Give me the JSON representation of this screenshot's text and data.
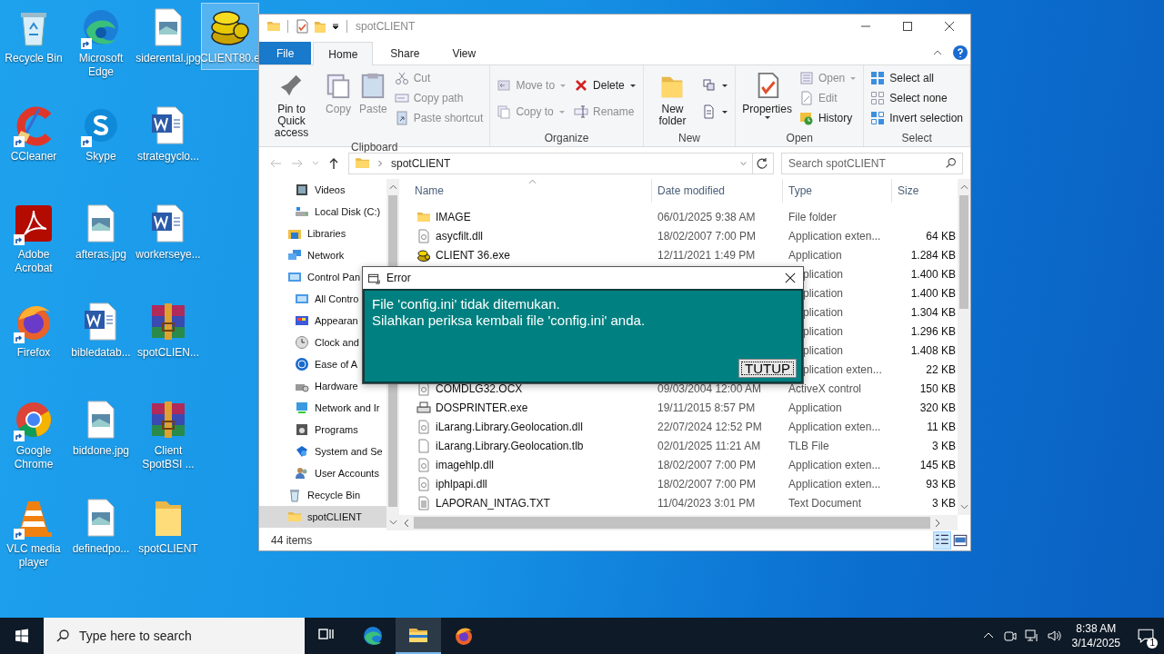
{
  "desktop": {
    "columns": [
      [
        {
          "label": "Recycle Bin",
          "kind": "recycle",
          "shortcut": false,
          "selected": false
        },
        {
          "label": "CCleaner",
          "kind": "ccleaner",
          "shortcut": true,
          "selected": false
        },
        {
          "label": "Adobe Acrobat",
          "kind": "acrobat",
          "shortcut": true,
          "selected": false
        },
        {
          "label": "Firefox",
          "kind": "firefox",
          "shortcut": true,
          "selected": false
        },
        {
          "label": "Google Chrome",
          "kind": "chrome",
          "shortcut": true,
          "selected": false
        },
        {
          "label": "VLC media player",
          "kind": "vlc",
          "shortcut": true,
          "selected": false
        }
      ],
      [
        {
          "label": "Microsoft Edge",
          "kind": "edge",
          "shortcut": true,
          "selected": false
        },
        {
          "label": "Skype",
          "kind": "skype",
          "shortcut": true,
          "selected": false
        },
        {
          "label": "afteras.jpg",
          "kind": "image",
          "shortcut": false,
          "selected": false
        },
        {
          "label": "bibledatab...",
          "kind": "word",
          "shortcut": false,
          "selected": false
        },
        {
          "label": "biddone.jpg",
          "kind": "image",
          "shortcut": false,
          "selected": false
        },
        {
          "label": "definedpo...",
          "kind": "image",
          "shortcut": false,
          "selected": false
        }
      ],
      [
        {
          "label": "siderental.jpg",
          "kind": "image",
          "shortcut": false,
          "selected": false
        },
        {
          "label": "strategyclo...",
          "kind": "word",
          "shortcut": false,
          "selected": false
        },
        {
          "label": "workerseye...",
          "kind": "word",
          "shortcut": false,
          "selected": false
        },
        {
          "label": "spotCLIEN...",
          "kind": "archive",
          "shortcut": false,
          "selected": false
        },
        {
          "label": "Client SpotBSI ...",
          "kind": "archive",
          "shortcut": false,
          "selected": false
        },
        {
          "label": "spotCLIENT",
          "kind": "folder",
          "shortcut": false,
          "selected": false
        }
      ],
      [
        {
          "label": "CLIENT80.e",
          "kind": "coins",
          "shortcut": false,
          "selected": true
        }
      ]
    ]
  },
  "explorer": {
    "title": "spotCLIENT",
    "tabs": [
      {
        "label": "File",
        "kind": "file",
        "selected": false
      },
      {
        "label": "Home",
        "kind": "tab",
        "selected": true
      },
      {
        "label": "Share",
        "kind": "tab",
        "selected": false
      },
      {
        "label": "View",
        "kind": "tab",
        "selected": false
      }
    ],
    "ribbon": [
      {
        "label": "Clipboard",
        "columns": [
          [
            {
              "label": "Pin to Quick access",
              "kind": "large",
              "disabled": false
            }
          ],
          [
            {
              "label": "Copy",
              "kind": "large",
              "disabled": true
            }
          ],
          [
            {
              "label": "Paste",
              "kind": "large",
              "disabled": true
            }
          ],
          [
            {
              "label": "Cut",
              "kind": "small",
              "disabled": true
            },
            {
              "label": "Copy path",
              "kind": "small",
              "disabled": true
            },
            {
              "label": "Paste shortcut",
              "kind": "small",
              "disabled": true
            }
          ]
        ]
      },
      {
        "label": "Organize",
        "columns": [
          [
            {
              "label": "Move to",
              "kind": "small",
              "disabled": true,
              "dropdown": true
            },
            {
              "label": "Copy to",
              "kind": "small",
              "disabled": true,
              "dropdown": true
            }
          ],
          [
            {
              "label": "Delete",
              "kind": "small",
              "disabled": false,
              "dropdown": true
            },
            {
              "label": "Rename",
              "kind": "small",
              "disabled": true
            }
          ]
        ]
      },
      {
        "label": "New",
        "columns": [
          [
            {
              "label": "New folder",
              "kind": "large",
              "disabled": false
            }
          ],
          [
            {
              "kind": "icon",
              "disabled": false,
              "dropdown": true
            },
            {
              "kind": "icon",
              "disabled": false,
              "dropdown": true
            }
          ]
        ]
      },
      {
        "label": "Open",
        "columns": [
          [
            {
              "label": "Properties",
              "kind": "large",
              "disabled": false,
              "dropdown": true
            }
          ],
          [
            {
              "label": "Open",
              "kind": "small",
              "disabled": true,
              "dropdown": true
            },
            {
              "label": "Edit",
              "kind": "small",
              "disabled": true
            },
            {
              "label": "History",
              "kind": "small",
              "disabled": false
            }
          ]
        ]
      },
      {
        "label": "Select",
        "columns": [
          [
            {
              "label": "Select all",
              "kind": "small",
              "disabled": false
            },
            {
              "label": "Select none",
              "kind": "small",
              "disabled": false
            },
            {
              "label": "Invert selection",
              "kind": "small",
              "disabled": false
            }
          ]
        ]
      }
    ],
    "address": "spotCLIENT",
    "search": {
      "placeholder": "Search spotCLIENT"
    },
    "nav_pane": {
      "items": [
        {
          "children": [
            {
              "label": "Videos",
              "selected": false
            },
            {
              "label": "Local Disk (C:)",
              "selected": false
            }
          ]
        },
        {
          "label": "Libraries",
          "selected": false
        },
        {
          "label": "Network",
          "selected": false
        },
        {
          "label": "Control Pan",
          "selected": false,
          "children": [
            {
              "label": "All Contro",
              "selected": false
            },
            {
              "label": "Appearan",
              "selected": false
            },
            {
              "label": "Clock and",
              "selected": false
            },
            {
              "label": "Ease of A",
              "selected": false
            },
            {
              "label": "Hardware",
              "selected": false
            },
            {
              "label": "Network and Ir",
              "selected": false
            },
            {
              "label": "Programs",
              "selected": false
            },
            {
              "label": "System and Se",
              "selected": false
            },
            {
              "label": "User Accounts",
              "selected": false
            }
          ]
        },
        {
          "label": "Recycle Bin",
          "selected": false
        },
        {
          "label": "spotCLIENT",
          "selected": true
        }
      ]
    },
    "file_list": {
      "columns": [
        "Name",
        "Date modified",
        "Type",
        "Size"
      ],
      "rows": [
        {
          "name": "IMAGE",
          "date": "06/01/2025 9:38 AM",
          "type": "File folder"
        },
        {
          "name": "asycfilt.dll",
          "date": "18/02/2007 7:00 PM",
          "type": "Application exten...",
          "size": "64 KB"
        },
        {
          "name": "CLIENT 36.exe",
          "date": "12/11/2021 1:49 PM",
          "type": "Application",
          "size": "1.284 KB"
        },
        {
          "type": "plication",
          "size": "1.400 KB"
        },
        {
          "type": "plication",
          "size": "1.400 KB"
        },
        {
          "type": "plication",
          "size": "1.304 KB"
        },
        {
          "type": "plication",
          "size": "1.296 KB"
        },
        {
          "type": "plication",
          "size": "1.408 KB"
        },
        {
          "type": "plication exten...",
          "size": "22 KB"
        },
        {
          "name": "COMDLG32.OCX",
          "date": "09/03/2004 12:00 AM",
          "type": "ActiveX control",
          "size": "150 KB"
        },
        {
          "name": "DOSPRINTER.exe",
          "date": "19/11/2015 8:57 PM",
          "type": "Application",
          "size": "320 KB"
        },
        {
          "name": "iLarang.Library.Geolocation.dll",
          "date": "22/07/2024 12:52 PM",
          "type": "Application exten...",
          "size": "11 KB"
        },
        {
          "name": "iLarang.Library.Geolocation.tlb",
          "date": "02/01/2025 11:21 AM",
          "type": "TLB File",
          "size": "3 KB"
        },
        {
          "name": "imagehlp.dll",
          "date": "18/02/2007 7:00 PM",
          "type": "Application exten...",
          "size": "145 KB"
        },
        {
          "name": "iphlpapi.dll",
          "date": "18/02/2007 7:00 PM",
          "type": "Application exten...",
          "size": "93 KB"
        },
        {
          "name": "LAPORAN_INTAG.TXT",
          "date": "11/04/2023 3:01 PM",
          "type": "Text Document",
          "size": "3 KB"
        }
      ]
    },
    "status": "44 items"
  },
  "dialog": {
    "title": "Error",
    "lines": [
      "File 'config.ini' tidak ditemukan.",
      "Silahkan periksa kembali file 'config.ini' anda."
    ],
    "button": "TUTUP"
  },
  "taskbar": {
    "search": {
      "placeholder": "Type here to search"
    },
    "apps": [
      {
        "active": false
      },
      {
        "active": false
      },
      {
        "active": true
      },
      {
        "active": false
      }
    ],
    "time": "8:38 AM",
    "date": "3/14/2025",
    "notifications": "1"
  }
}
